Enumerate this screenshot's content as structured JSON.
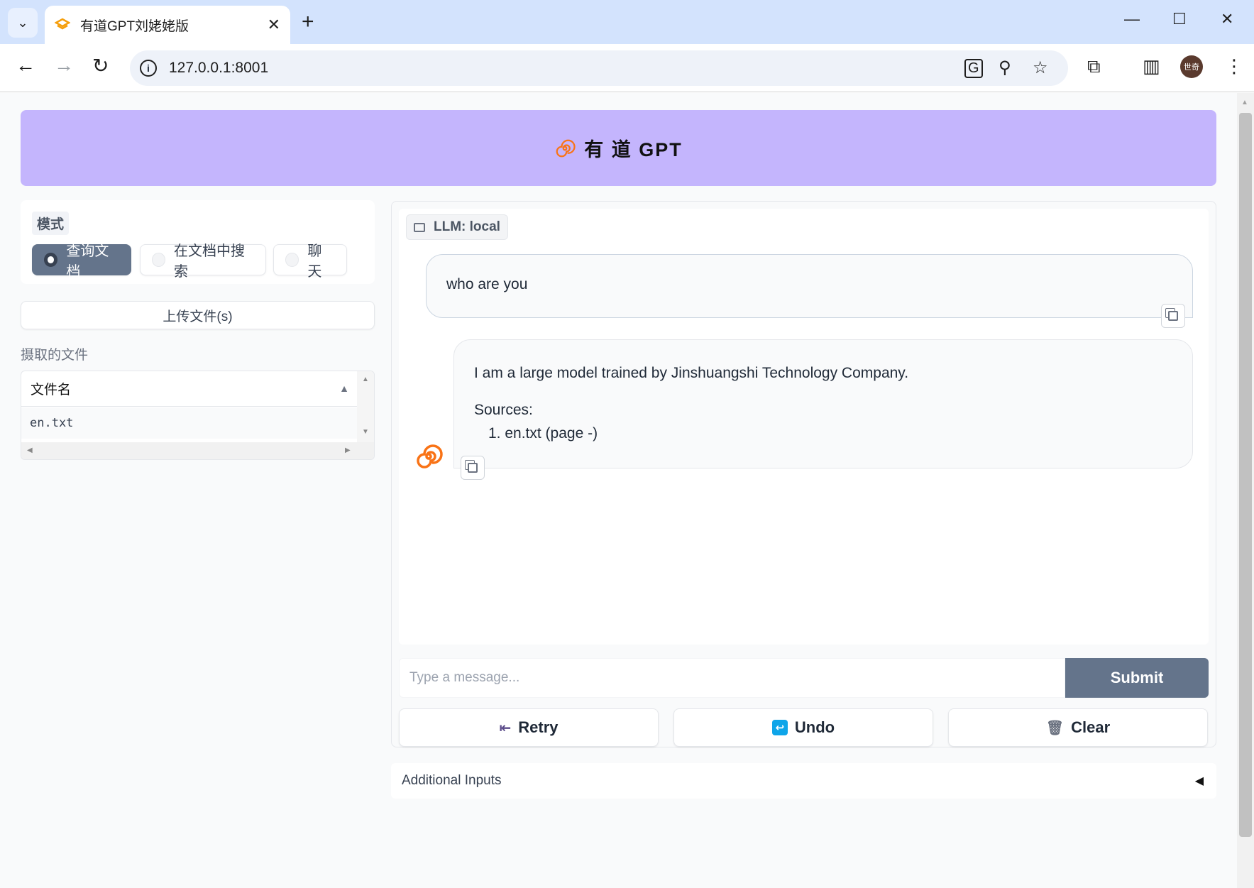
{
  "browser": {
    "tab_title": "有道GPT刘姥姥版",
    "url": "127.0.0.1:8001",
    "profile_initials": "世奇",
    "icons": [
      "tab-dropdown-icon",
      "favicon-icon",
      "close-tab-icon",
      "new-tab-icon",
      "minimize-icon",
      "maximize-icon",
      "close-window-icon",
      "back-icon",
      "forward-icon",
      "reload-icon",
      "site-info-icon",
      "translate-icon",
      "zoom-icon",
      "bookmark-star-icon",
      "extensions-icon",
      "side-panel-icon",
      "menu-icon"
    ]
  },
  "header": {
    "title": "有 道 GPT"
  },
  "sidebar": {
    "mode_label": "模式",
    "modes": [
      {
        "label": "查询文档",
        "selected": true
      },
      {
        "label": "在文档中搜索",
        "selected": false
      },
      {
        "label": "聊天",
        "selected": false
      }
    ],
    "upload_label": "上传文件(s)",
    "files_label": "摄取的文件",
    "files_table": {
      "header": "文件名",
      "rows": [
        "en.txt"
      ]
    }
  },
  "chat": {
    "llm_label": "LLM: local",
    "messages": [
      {
        "role": "user",
        "text": "who are you"
      },
      {
        "role": "bot",
        "text": "I am a large model trained by Jinshuangshi Technology Company.",
        "sources_label": "Sources:",
        "sources": [
          "1. en.txt (page -)"
        ]
      }
    ],
    "input_placeholder": "Type a message...",
    "submit_label": "Submit",
    "retry_label": "Retry",
    "undo_label": "Undo",
    "clear_label": "Clear"
  },
  "additional_inputs_label": "Additional Inputs",
  "colors": {
    "header_bg": "#c4b5fd",
    "accent": "#64748b",
    "logo_orange": "#f97316"
  }
}
